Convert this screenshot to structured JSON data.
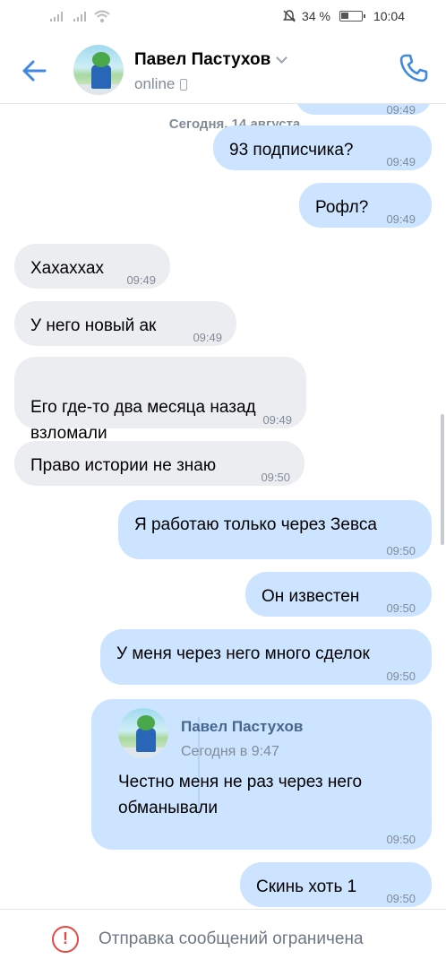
{
  "status_bar": {
    "battery": "34 %",
    "time": "10:04"
  },
  "header": {
    "contact_name": "Павел Пастухов",
    "status": "online"
  },
  "chat": {
    "date_separator": "Сегодня, 14 августа",
    "partial_top_time": "09:49",
    "messages": [
      {
        "dir": "out",
        "text": "93 подписчика?",
        "time": "09:49"
      },
      {
        "dir": "out",
        "text": "Рофл?",
        "time": "09:49"
      },
      {
        "dir": "in",
        "text": "Хахаххах",
        "time": "09:49"
      },
      {
        "dir": "in",
        "text": "У него новый ак",
        "time": "09:49"
      },
      {
        "dir": "in",
        "text": "Его где-то два месяца назад\nвзломали",
        "time": "09:49"
      },
      {
        "dir": "in",
        "text": "Право истории не знаю",
        "time": "09:50"
      },
      {
        "dir": "out",
        "text": "Я работаю только через Зевса",
        "time": "09:50"
      },
      {
        "dir": "out",
        "text": "Он известен",
        "time": "09:50"
      },
      {
        "dir": "out",
        "text": "У меня через него много сделок",
        "time": "09:50"
      },
      {
        "dir": "out",
        "text": "Скинь хоть 1",
        "time": "09:50"
      }
    ],
    "forwarded": {
      "author": "Павел Пастухов",
      "date": "Сегодня в 9:47",
      "text": "Честно меня не раз через него обманывали",
      "time": "09:50"
    }
  },
  "footer": {
    "notice": "Отправка сообщений ограничена",
    "icon": "!"
  },
  "colors": {
    "accent": "#3f8ae0",
    "incoming_bubble": "#ebedf0",
    "outgoing_bubble": "#cce4ff",
    "error": "#e64646",
    "secondary_text": "#818c99"
  }
}
